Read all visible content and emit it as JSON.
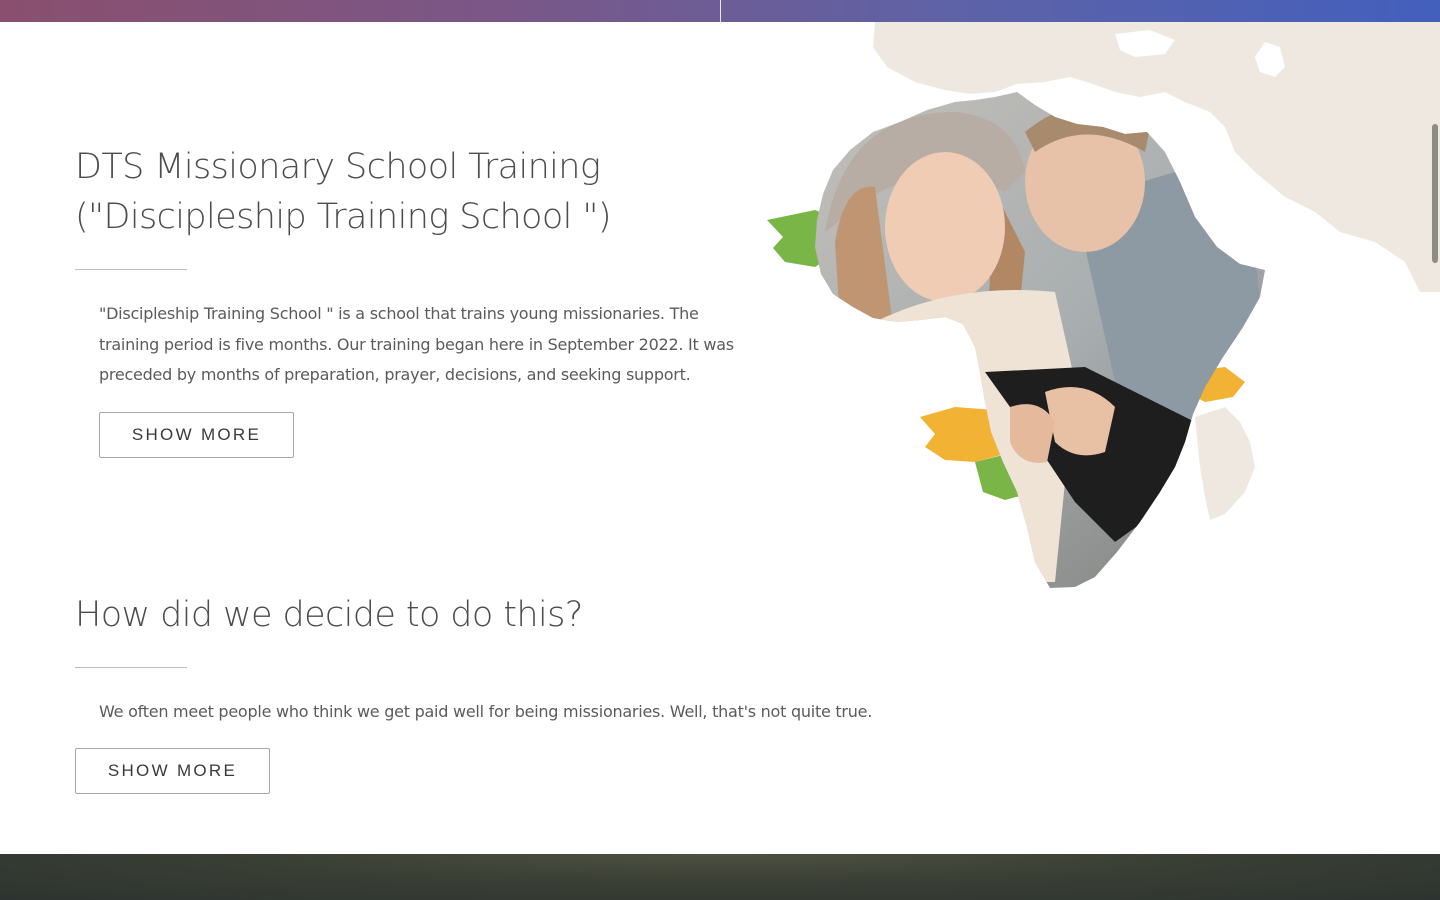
{
  "header": {
    "banner_colors": [
      "#8a4f6e",
      "#4360bd"
    ]
  },
  "sections": [
    {
      "title_line1": "DTS Missionary School Training",
      "title_line2": "(\"Discipleship Training School \")",
      "paragraph_line1": "\"Discipleship Training School \" is a school that trains young missionaries. The",
      "paragraph_line2": "training period is five months. Our training began here in September 2022. It was",
      "paragraph_line3": "preceded by months of preparation, prayer, decisions, and seeking support.",
      "button_label": "SHOW MORE"
    },
    {
      "title": "How did we decide to do this?",
      "paragraph": "We often meet people who think we get paid well for being missionaries. Well, that's not quite true.",
      "button_label": "SHOW MORE"
    }
  ],
  "hero": {
    "icon": "africa-map-photo-icon",
    "map_color": "#efe8e1",
    "accent_colors": [
      "#7ab547",
      "#f2b233"
    ]
  },
  "footer": {
    "color": "#323830"
  }
}
